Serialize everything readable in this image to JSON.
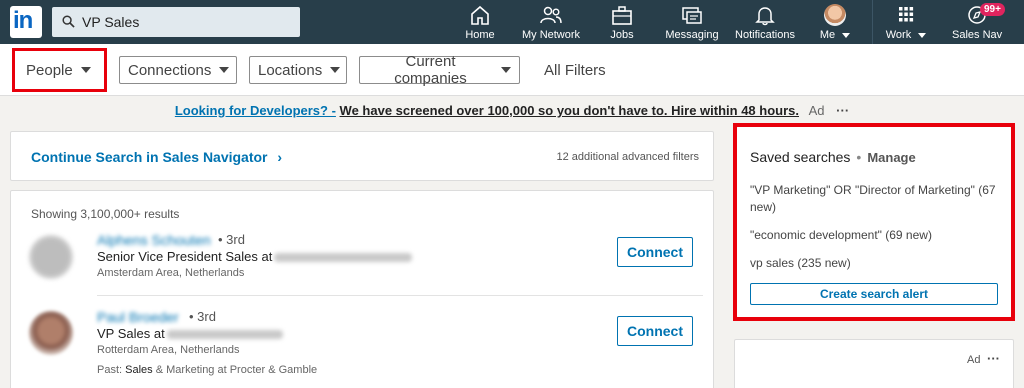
{
  "nav": {
    "search_value": "VP Sales",
    "items": [
      {
        "label": "Home",
        "icon": "home-icon"
      },
      {
        "label": "My Network",
        "icon": "network-icon"
      },
      {
        "label": "Jobs",
        "icon": "briefcase-icon"
      },
      {
        "label": "Messaging",
        "icon": "messaging-icon"
      },
      {
        "label": "Notifications",
        "icon": "bell-icon"
      },
      {
        "label": "Me",
        "icon": "avatar"
      },
      {
        "label": "Work",
        "icon": "grid-icon"
      },
      {
        "label": "Sales Nav",
        "icon": "compass-icon"
      }
    ],
    "sales_badge": "99+"
  },
  "filters": {
    "people": "People",
    "connections": "Connections",
    "locations": "Locations",
    "current_companies": "Current companies",
    "all_filters": "All Filters"
  },
  "ad_banner": {
    "link": "Looking for Developers? -",
    "text": "We have screened over 100,000 so you don't have to. Hire within 48 hours.",
    "ad_label": "Ad"
  },
  "continue_card": {
    "title": "Continue Search in Sales Navigator",
    "meta": "12 additional advanced filters"
  },
  "results": {
    "count": "Showing 3,100,000+ results",
    "items": [
      {
        "degree": "• 3rd",
        "headline": "Senior Vice President Sales at",
        "location": "Amsterdam Area, Netherlands",
        "connect": "Connect"
      },
      {
        "degree": "• 3rd",
        "headline": "VP Sales at",
        "location": "Rotterdam Area, Netherlands",
        "past_prefix": "Past:",
        "past_highlight": "Sales",
        "past_rest": "& Marketing at Procter & Gamble",
        "connect": "Connect"
      }
    ]
  },
  "saved_searches": {
    "title": "Saved searches",
    "manage": "Manage",
    "items": [
      "\"VP Marketing\" OR \"Director of Marketing\" (67 new)",
      "\"economic development\" (69 new)",
      "vp sales (235 new)"
    ],
    "alert_button": "Create search alert"
  },
  "ad_card": {
    "ad_label": "Ad",
    "dots": "···"
  },
  "colors": {
    "nav_bg": "#283e4a",
    "link_blue": "#0073b1",
    "highlight_red": "#e8000b",
    "badge_red": "#e0245e"
  }
}
